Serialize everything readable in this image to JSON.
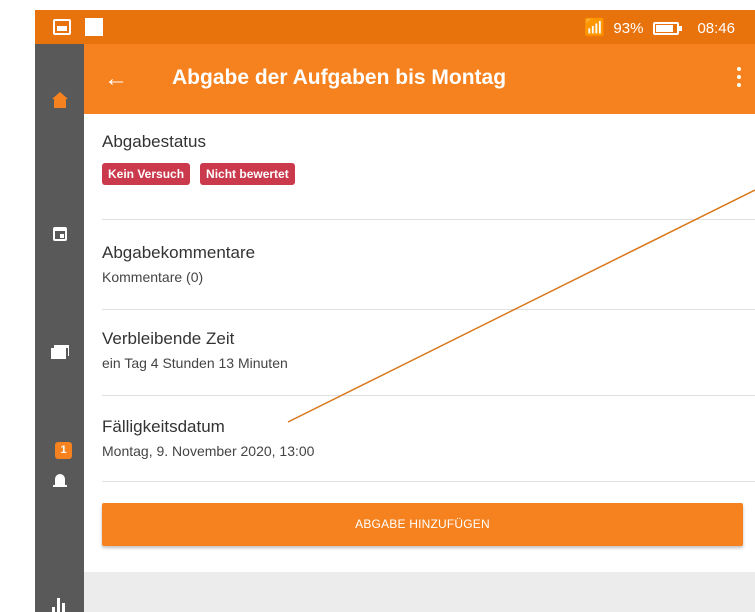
{
  "status_bar": {
    "battery": "93%",
    "time": "08:46"
  },
  "nav": {
    "items": [
      {
        "name": "home",
        "icon": "home-icon"
      },
      {
        "name": "calendar",
        "icon": "calendar-icon"
      },
      {
        "name": "messages",
        "icon": "messages-icon"
      },
      {
        "name": "notifications",
        "icon": "bell-icon",
        "badge": "1"
      },
      {
        "name": "grades",
        "icon": "grades-icon"
      }
    ]
  },
  "app_bar": {
    "title": "Abgabe der Aufgaben bis Montag",
    "back_icon": "arrow-left-icon",
    "menu_icon": "more-vert-icon"
  },
  "submission_status": {
    "title": "Abgabestatus",
    "badges": [
      "Kein Versuch",
      "Nicht bewertet"
    ]
  },
  "comments": {
    "title": "Abgabekommentare",
    "value": "Kommentare (0)"
  },
  "time_remaining": {
    "title": "Verbleibende Zeit",
    "value": "ein Tag 4 Stunden 13 Minuten"
  },
  "due_date": {
    "title": "Fälligkeitsdatum",
    "value": "Montag, 9. November 2020, 13:00"
  },
  "actions": {
    "add_submission": "ABGABE HINZUFÜGEN"
  },
  "colors": {
    "accent": "#f5821f",
    "status_bar": "#e8720c",
    "rail": "#595959",
    "badge": "#ca3a4c",
    "annotation": "#d9771a"
  }
}
